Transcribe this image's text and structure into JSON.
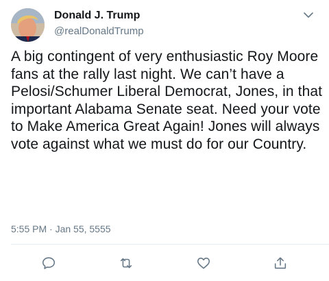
{
  "tweet": {
    "author": {
      "display_name": "Donald J. Trump",
      "handle": "@realDonaldTrump"
    },
    "text": "A big contingent of very enthusiastic Roy Moore fans at the rally last night. We can’t have a Pelosi/Schumer Liberal Democrat, Jones, in that important Alabama Senate seat. Need your vote to Make America Great Again! Jones will always vote against what we must do for our Country.",
    "timestamp": "5:55 PM · Jan 55, 5555"
  },
  "icons": {
    "menu": "chevron-down-icon",
    "reply": "reply-icon",
    "retweet": "retweet-icon",
    "like": "like-heart-icon",
    "share": "share-icon"
  },
  "colors": {
    "text": "#14171a",
    "secondary": "#657786",
    "icon": "#657786",
    "divider": "#e6ecf0"
  }
}
